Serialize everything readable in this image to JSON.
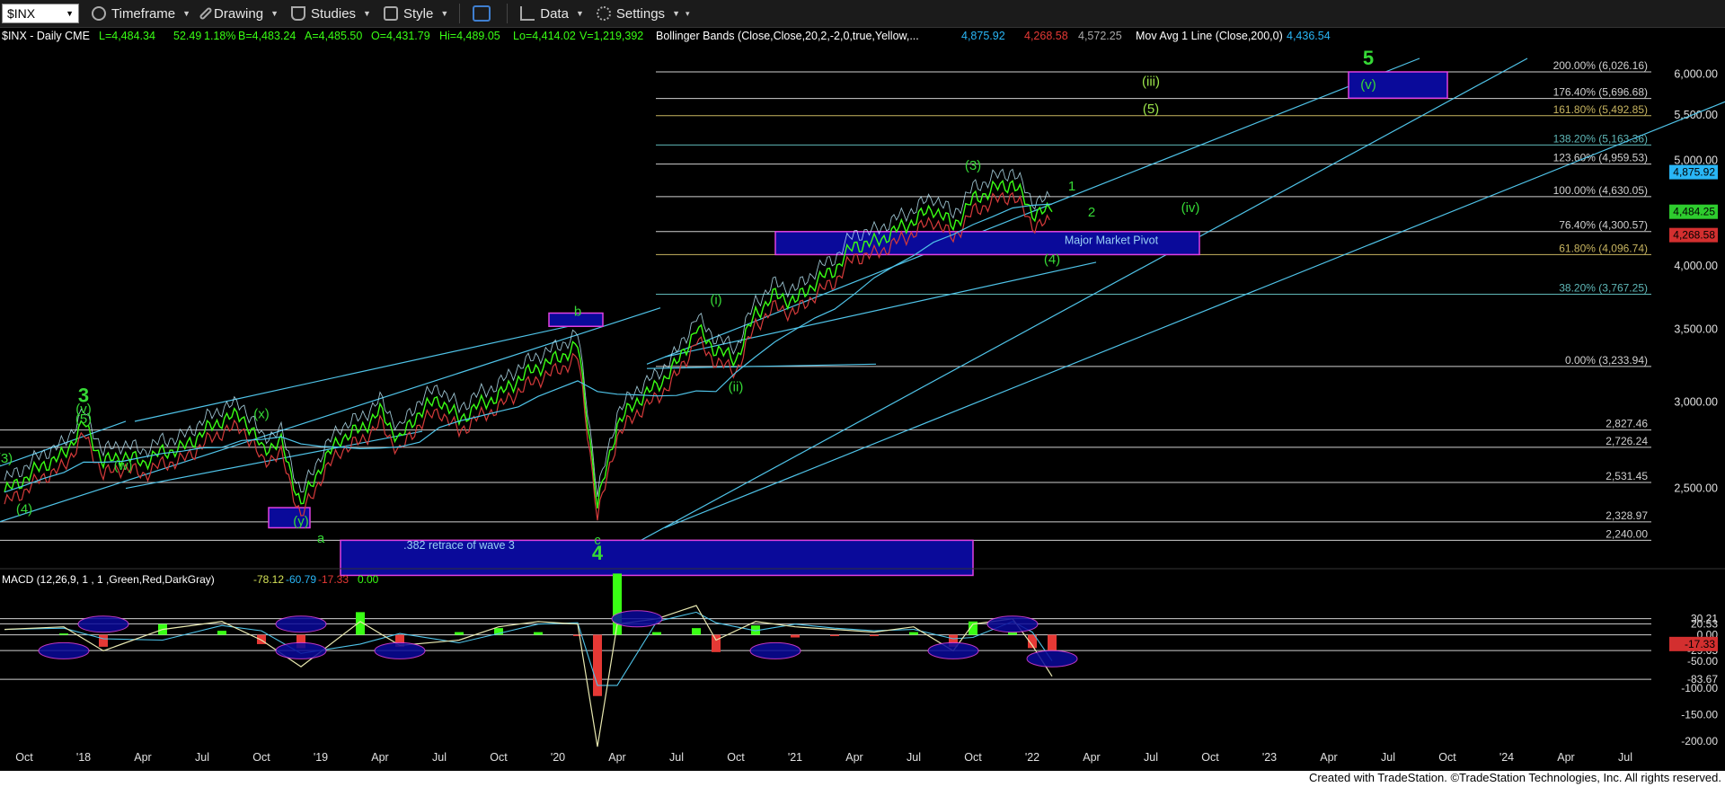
{
  "toolbar": {
    "symbol": "$INX",
    "items": [
      "Timeframe",
      "Drawing",
      "Studies",
      "Style",
      "Data",
      "Settings"
    ]
  },
  "legend": {
    "instrument": "$INX - Daily  CME",
    "low": "L=4,484.34",
    "chg": "52.49",
    "pct": "1.18%",
    "bid": "B=4,483.24",
    "ask": "A=4,485.50",
    "open": "O=4,431.79",
    "high": "Hi=4,489.05",
    "lo2": "Lo=4,414.02",
    "vol": "V=1,219,392",
    "bb_label": "Bollinger Bands (Close,Close,20,2,-2,0,true,Yellow,...",
    "bb_v1": "4,875.92",
    "bb_v2": "4,268.58",
    "bb_v3": "4,572.25",
    "ma_label": "Mov Avg 1 Line (Close,200,0)",
    "ma_v": "4,436.54"
  },
  "macd_legend": {
    "label": "MACD (12,26,9, 1 , 1 ,Green,Red,DarkGray)",
    "v1": "-78.12",
    "v2": "-60.79",
    "v3": "-17.33",
    "v4": "0.00"
  },
  "footer": "Created with TradeStation. ©TradeStation Technologies, Inc. All rights reserved.",
  "colors": {
    "bg": "#000000",
    "price": "#39ff14",
    "bb_upper": "#ffffff",
    "ma": "#4fc3e8",
    "lower": "#d43a3a",
    "fib_line": "#d0d0d0",
    "box_fill": "#0a0a9a",
    "box_stroke": "#e040e0",
    "label_green": "#36d936"
  },
  "chart_data": [
    {
      "type": "line",
      "title": "$INX - Daily",
      "y_scale": "log",
      "ylim": [
        2150,
        6200
      ],
      "x_ticks": [
        "Oct",
        "'18",
        "Apr",
        "Jul",
        "Oct",
        "'19",
        "Apr",
        "Jul",
        "Oct",
        "'20",
        "Apr",
        "Jul",
        "Oct",
        "'21",
        "Apr",
        "Jul",
        "Oct",
        "'22",
        "Apr",
        "Jul",
        "Oct",
        "'23",
        "Apr",
        "Jul",
        "Oct",
        "'24",
        "Apr",
        "Jul"
      ],
      "y_ticks": [
        "6,000.00",
        "5,500.00",
        "5,000.00",
        "4,500.00",
        "4,000.00",
        "3,500.00",
        "3,000.00",
        "2,500.00"
      ],
      "series": [
        {
          "name": "$INX",
          "x": [
            "2017-09",
            "2017-10",
            "2017-11",
            "2017-12",
            "2018-01",
            "2018-02",
            "2018-03",
            "2018-04",
            "2018-05",
            "2018-06",
            "2018-07",
            "2018-08",
            "2018-09",
            "2018-10",
            "2018-11",
            "2018-12",
            "2019-01",
            "2019-02",
            "2019-03",
            "2019-04",
            "2019-05",
            "2019-06",
            "2019-07",
            "2019-08",
            "2019-09",
            "2019-10",
            "2019-11",
            "2019-12",
            "2020-01",
            "2020-02",
            "2020-03",
            "2020-04",
            "2020-05",
            "2020-06",
            "2020-07",
            "2020-08",
            "2020-09",
            "2020-10",
            "2020-11",
            "2020-12",
            "2021-01",
            "2021-02",
            "2021-03",
            "2021-04",
            "2021-05",
            "2021-06",
            "2021-07",
            "2021-08",
            "2021-09",
            "2021-10",
            "2021-11",
            "2021-12",
            "2022-01",
            "2022-02"
          ],
          "values": [
            2480,
            2550,
            2630,
            2680,
            2870,
            2640,
            2680,
            2640,
            2700,
            2720,
            2810,
            2890,
            2920,
            2720,
            2750,
            2410,
            2620,
            2780,
            2830,
            2940,
            2770,
            2940,
            3020,
            2890,
            2980,
            3040,
            3150,
            3230,
            3290,
            3380,
            2400,
            2860,
            3010,
            3100,
            3250,
            3500,
            3350,
            3280,
            3620,
            3760,
            3710,
            3860,
            3970,
            4180,
            4200,
            4300,
            4400,
            4520,
            4350,
            4600,
            4700,
            4770,
            4480,
            4484
          ]
        }
      ],
      "horizontal_levels": [
        {
          "label": "200.00% (6,026.16)",
          "value": 6026.16
        },
        {
          "label": "176.40% (5,696.68)",
          "value": 5696.68
        },
        {
          "label": "161.80% (5,492.85)",
          "value": 5492.85
        },
        {
          "label": "138.20% (5,163.36)",
          "value": 5163.36
        },
        {
          "label": "123.60% (4,959.53)",
          "value": 4959.53
        },
        {
          "label": "100.00% (4,630.05)",
          "value": 4630.05
        },
        {
          "label": "76.40% (4,300.57)",
          "value": 4300.57
        },
        {
          "label": "61.80% (4,096.74)",
          "value": 4096.74
        },
        {
          "label": "38.20% (3,767.25)",
          "value": 3767.25
        },
        {
          "label": "0.00% (3,233.94)",
          "value": 3233.94
        },
        {
          "label": "2,827.46",
          "value": 2827.46
        },
        {
          "label": "2,726.24",
          "value": 2726.24
        },
        {
          "label": "2,531.45",
          "value": 2531.45
        },
        {
          "label": "2,328.97",
          "value": 2328.97
        },
        {
          "label": "2,240.00",
          "value": 2240.0
        }
      ],
      "price_flags": [
        {
          "text": "4,875.92",
          "value": 4875.92,
          "color": "#29b6f6"
        },
        {
          "text": "4,484.25",
          "value": 4484.25,
          "color": "#2ecc2e"
        },
        {
          "text": "4,268.58",
          "value": 4268.58,
          "color": "#d32f2f"
        }
      ],
      "annotations": [
        {
          "text": "5",
          "x": "2023-06",
          "value": 6120,
          "color": "#36d936",
          "big": true
        },
        {
          "text": "(v)",
          "x": "2023-06",
          "value": 5810,
          "color": "#36d936"
        },
        {
          "text": "(iii)",
          "x": "2022-07",
          "value": 5850,
          "color": "#9be34a"
        },
        {
          "text": "(5)",
          "x": "2022-07",
          "value": 5520,
          "color": "#9be34a"
        },
        {
          "text": "(iv)",
          "x": "2022-09",
          "value": 4480,
          "color": "#36d936"
        },
        {
          "text": "Major Market Pivot",
          "x": "2022-05",
          "value": 4190,
          "color": "#9ad0f5"
        },
        {
          "text": ".382 retrace of wave 3",
          "x": "2019-08",
          "value": 2200,
          "color": "#9ad0f5"
        },
        {
          "text": "b",
          "x": "2020-02",
          "value": 3600,
          "color": "#36d936"
        },
        {
          "text": "c",
          "x": "2020-03",
          "value": 2220,
          "color": "#36d936"
        },
        {
          "text": "4",
          "x": "2020-03",
          "value": 2150,
          "color": "#36d936",
          "big": true
        },
        {
          "text": "a",
          "x": "2019-01",
          "value": 2230,
          "color": "#36d936"
        },
        {
          "text": "3",
          "x": "2018-01",
          "value": 3000,
          "color": "#36d936",
          "big": true
        },
        {
          "text": "(v)",
          "x": "2018-01",
          "value": 2930,
          "color": "#36d936"
        },
        {
          "text": "(5)",
          "x": "2018-01",
          "value": 2870,
          "color": "#36d936"
        },
        {
          "text": "(3)",
          "x": "2017-09",
          "value": 2640,
          "color": "#36d936"
        },
        {
          "text": "(4)",
          "x": "2017-10",
          "value": 2370,
          "color": "#36d936"
        },
        {
          "text": "(w)",
          "x": "2018-03",
          "value": 2600,
          "color": "#36d936"
        },
        {
          "text": "(x)",
          "x": "2018-10",
          "value": 2900,
          "color": "#36d936"
        },
        {
          "text": "(y)",
          "x": "2018-12",
          "value": 2310,
          "color": "#36d936"
        },
        {
          "text": "(i)",
          "x": "2020-09",
          "value": 3690,
          "color": "#36d936"
        },
        {
          "text": "(ii)",
          "x": "2020-10",
          "value": 3070,
          "color": "#36d936"
        },
        {
          "text": "(3)",
          "x": "2021-10",
          "value": 4900,
          "color": "#36d936"
        },
        {
          "text": "(4)",
          "x": "2022-02",
          "value": 4020,
          "color": "#36d936"
        },
        {
          "text": "1",
          "x": "2022-03",
          "value": 4690,
          "color": "#36d936"
        },
        {
          "text": "2",
          "x": "2022-04",
          "value": 4440,
          "color": "#36d936"
        }
      ]
    },
    {
      "type": "line",
      "title": "MACD (12,26,9, 1 , 1 ,Green,Red,DarkGray)",
      "ylim": [
        -220,
        60
      ],
      "y_ticks": [
        "30.21",
        "20.53",
        "0.00",
        "-29.65",
        "-50.00",
        "-83.67",
        "-100.00",
        "-150.00",
        "-200.00"
      ],
      "series": [
        {
          "name": "MACD",
          "x": [
            "2017-09",
            "2017-12",
            "2018-02",
            "2018-05",
            "2018-08",
            "2018-10",
            "2018-12",
            "2019-03",
            "2019-05",
            "2019-08",
            "2019-10",
            "2019-12",
            "2020-02",
            "2020-03",
            "2020-04",
            "2020-06",
            "2020-08",
            "2020-09",
            "2020-11",
            "2021-01",
            "2021-03",
            "2021-05",
            "2021-07",
            "2021-09",
            "2021-10",
            "2021-12",
            "2022-01",
            "2022-02"
          ],
          "values": [
            10,
            15,
            -30,
            10,
            25,
            -10,
            -60,
            25,
            -20,
            -10,
            15,
            25,
            20,
            -210,
            20,
            30,
            55,
            -10,
            25,
            15,
            10,
            5,
            15,
            -30,
            20,
            30,
            -20,
            -78
          ]
        }
      ],
      "macd_levels": [
        {
          "label": "30.21",
          "value": 30.21
        },
        {
          "label": "20.53",
          "value": 20.53
        },
        {
          "label": "0.00",
          "value": 0
        },
        {
          "label": "-29.65",
          "value": -29.65
        },
        {
          "label": "-83.67",
          "value": -83.67
        }
      ],
      "macd_flag": {
        "text": "-17.33",
        "value": -17.33
      }
    }
  ]
}
